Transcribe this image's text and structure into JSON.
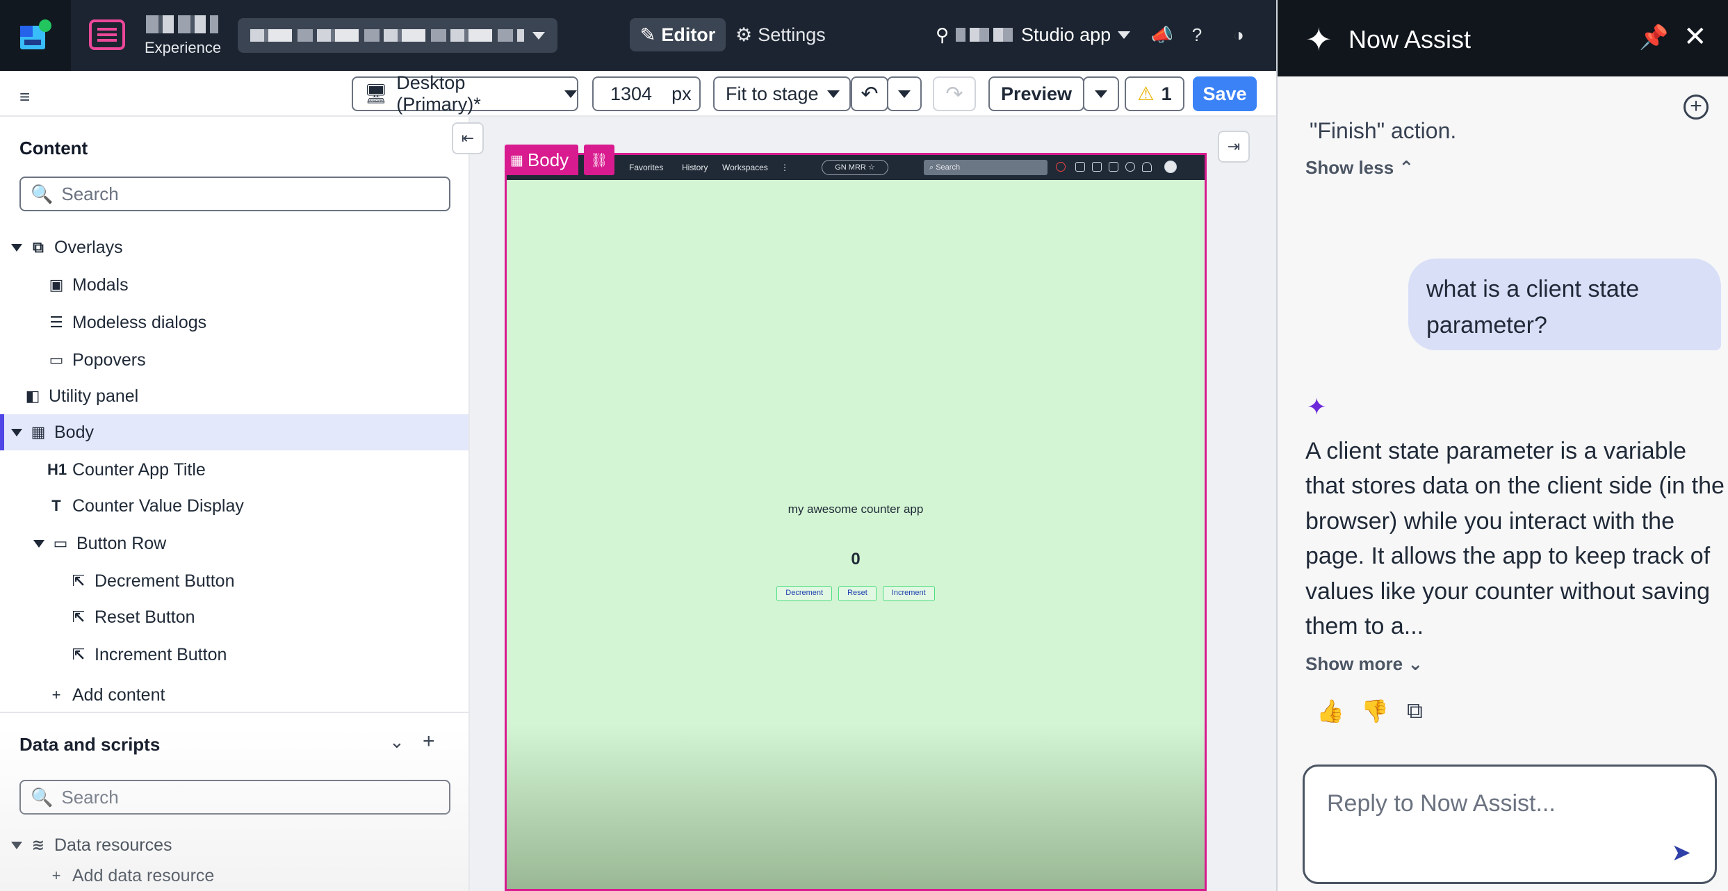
{
  "header": {
    "experience_label": "Experience",
    "editor_label": "Editor",
    "settings_label": "Settings",
    "studio_label": "Studio app"
  },
  "toolbar": {
    "device_label": "Desktop (Primary)*",
    "width_value": "1304",
    "width_unit": "px",
    "fit_label": "Fit to stage",
    "preview_label": "Preview",
    "warning_count": "1",
    "save_label": "Save"
  },
  "content": {
    "title": "Content",
    "search_placeholder": "Search",
    "tree": [
      {
        "label": "Overlays",
        "icon": "overlays-icon"
      },
      {
        "label": "Modals",
        "icon": "modal-icon"
      },
      {
        "label": "Modeless dialogs",
        "icon": "modeless-dialog-icon"
      },
      {
        "label": "Popovers",
        "icon": "popover-icon"
      },
      {
        "label": "Utility panel",
        "icon": "utility-panel-icon"
      },
      {
        "label": "Body",
        "icon": "body-layout-icon"
      },
      {
        "label": "Counter App Title",
        "icon": "heading-icon"
      },
      {
        "label": "Counter Value Display",
        "icon": "text-icon"
      },
      {
        "label": "Button Row",
        "icon": "container-icon"
      },
      {
        "label": "Decrement Button",
        "icon": "button-icon"
      },
      {
        "label": "Reset Button",
        "icon": "button-icon"
      },
      {
        "label": "Increment Button",
        "icon": "button-icon"
      }
    ],
    "add_content": "Add content"
  },
  "data_scripts": {
    "title": "Data and scripts",
    "search_placeholder": "Search",
    "data_resources": "Data resources",
    "add_data_resource": "Add data resource"
  },
  "canvas": {
    "body_tag": "Body",
    "nav": [
      "Favorites",
      "History",
      "Workspaces",
      "⋮"
    ],
    "nav_chip": "GN MRR ☆",
    "nav_search": "Search",
    "app_title": "my awesome counter app",
    "counter_value": "0",
    "buttons": [
      "Decrement",
      "Reset",
      "Increment"
    ]
  },
  "assist": {
    "title": "Now Assist",
    "cut_text": "\"Finish\" action.",
    "show_less": "Show less",
    "user_question": "what is a client state parameter?",
    "answer": "A client state parameter is a variable that stores data on the client side (in the browser) while you interact with the page. It allows the app to keep track of values like your counter without saving them to a...",
    "show_more": "Show more",
    "reply_placeholder": "Reply to Now Assist..."
  },
  "colors": {
    "header_bg": "#1b2430",
    "accent_pink": "#d81b8f",
    "save_blue": "#3b82f6",
    "canvas_green": "#d3f5d3",
    "selected_row": "#e4e8fb"
  }
}
